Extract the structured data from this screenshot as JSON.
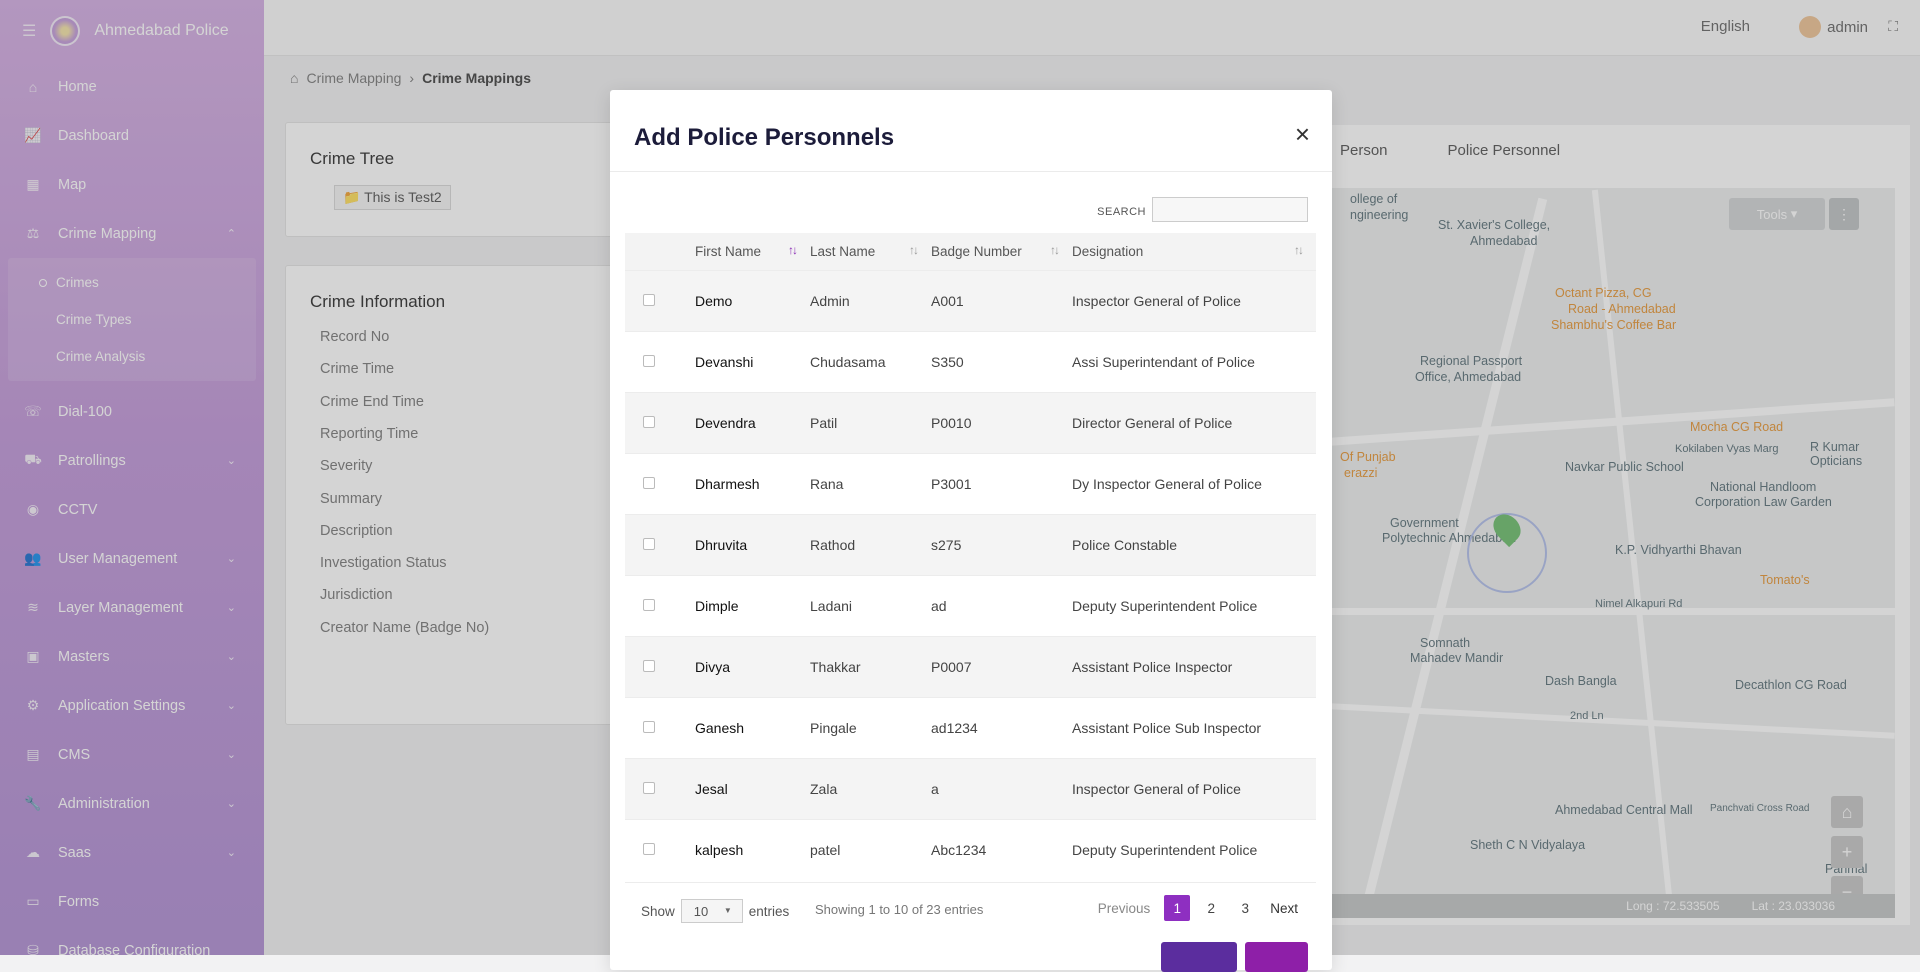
{
  "app": {
    "brand": "Ahmedabad Police"
  },
  "topbar": {
    "language": "English",
    "user": "admin"
  },
  "sidebar": {
    "items": [
      {
        "label": "Home",
        "icon": "home-icon"
      },
      {
        "label": "Dashboard",
        "icon": "chart-line-icon"
      },
      {
        "label": "Map",
        "icon": "map-icon"
      },
      {
        "label": "Crime Mapping",
        "icon": "crime-icon",
        "expanded": true
      },
      {
        "label": "Dial-100",
        "icon": "phone-icon"
      },
      {
        "label": "Patrollings",
        "icon": "car-icon"
      },
      {
        "label": "CCTV",
        "icon": "camera-icon"
      },
      {
        "label": "User Management",
        "icon": "users-icon"
      },
      {
        "label": "Layer Management",
        "icon": "layers-icon"
      },
      {
        "label": "Masters",
        "icon": "masters-icon"
      },
      {
        "label": "Application Settings",
        "icon": "settings-icon"
      },
      {
        "label": "CMS",
        "icon": "cms-icon"
      },
      {
        "label": "Administration",
        "icon": "wrench-icon"
      },
      {
        "label": "Saas",
        "icon": "saas-icon"
      },
      {
        "label": "Forms",
        "icon": "forms-icon"
      },
      {
        "label": "Database Configuration",
        "icon": "database-icon"
      }
    ],
    "crime_sub": [
      "Crimes",
      "Crime Types",
      "Crime Analysis"
    ]
  },
  "breadcrumb": {
    "parent": "Crime Mapping",
    "current": "Crime Mappings"
  },
  "crime_tree": {
    "title": "Crime Tree",
    "node": "This is Test2"
  },
  "crime_info": {
    "title": "Crime Information",
    "fields": [
      "Record No",
      "Crime Time",
      "Crime End Time",
      "Reporting Time",
      "Severity",
      "Summary",
      "Description",
      "Investigation Status",
      "Jurisdiction",
      "Creator Name (Badge No)"
    ]
  },
  "map_panel": {
    "tabs": [
      "Person",
      "Police Personnel"
    ],
    "tools_label": "Tools",
    "long": "Long : 72.533505",
    "lat": "Lat : 23.033036",
    "labels": [
      "ollege of",
      "ngineering",
      "St. Xavier's College,",
      "Ahmedabad",
      "Octant Pizza, CG",
      "Road - Ahmedabad",
      "Shambhu's Coffee Bar",
      "Regional Passport",
      "Office, Ahmedabad",
      "Mocha CG Road",
      "R Kumar Opticians",
      "Kokilaben Vyas Marg",
      "Navkar Public School",
      "National Handloom",
      "Corporation Law Garden",
      "Government",
      "Polytechnic Ahmedabad",
      "K.P. Vidhyarthi Bhavan",
      "Tomato's",
      "Nimel Alkapuri Rd",
      "Somnath",
      "Mahadev Mandir",
      "Dash Bangla",
      "Decathlon CG Road",
      "2nd Ln",
      "Ahmedabad Central Mall",
      "Sheth C N Vidyalaya",
      "Panchvati Cross Road",
      "Parimal",
      "Of Punjab",
      "erazzi"
    ]
  },
  "modal": {
    "title": "Add Police Personnels",
    "close": "×",
    "search_label": "SEARCH",
    "columns": [
      "First Name",
      "Last Name",
      "Badge Number",
      "Designation"
    ],
    "rows": [
      {
        "first": "Demo",
        "last": "Admin",
        "badge": "A001",
        "designation": "Inspector General of Police"
      },
      {
        "first": "Devanshi",
        "last": "Chudasama",
        "badge": "S350",
        "designation": "Assi Superintendant of Police"
      },
      {
        "first": "Devendra",
        "last": "Patil",
        "badge": "P0010",
        "designation": "Director General of Police"
      },
      {
        "first": "Dharmesh",
        "last": "Rana",
        "badge": "P3001",
        "designation": "Dy Inspector General of Police"
      },
      {
        "first": "Dhruvita",
        "last": "Rathod",
        "badge": "s275",
        "designation": "Police Constable"
      },
      {
        "first": "Dimple",
        "last": "Ladani",
        "badge": "ad",
        "designation": "Deputy Superintendent Police"
      },
      {
        "first": "Divya",
        "last": "Thakkar",
        "badge": "P0007",
        "designation": "Assistant Police Inspector"
      },
      {
        "first": "Ganesh",
        "last": "Pingale",
        "badge": "ad1234",
        "designation": "Assistant Police Sub Inspector"
      },
      {
        "first": "Jesal",
        "last": "Zala",
        "badge": "a",
        "designation": "Inspector General of Police"
      },
      {
        "first": "kalpesh",
        "last": "patel",
        "badge": "Abc1234",
        "designation": "Deputy Superintendent Police"
      }
    ],
    "show_label": "Show",
    "page_size": "10",
    "entries_label": "entries",
    "info": "Showing 1 to 10 of 23 entries",
    "pager": {
      "prev": "Previous",
      "pages": [
        "1",
        "2",
        "3"
      ],
      "next": "Next",
      "current": "1"
    },
    "colors": {
      "accent": "#8e2fc1",
      "button_dark": "#5b2d9e"
    }
  }
}
